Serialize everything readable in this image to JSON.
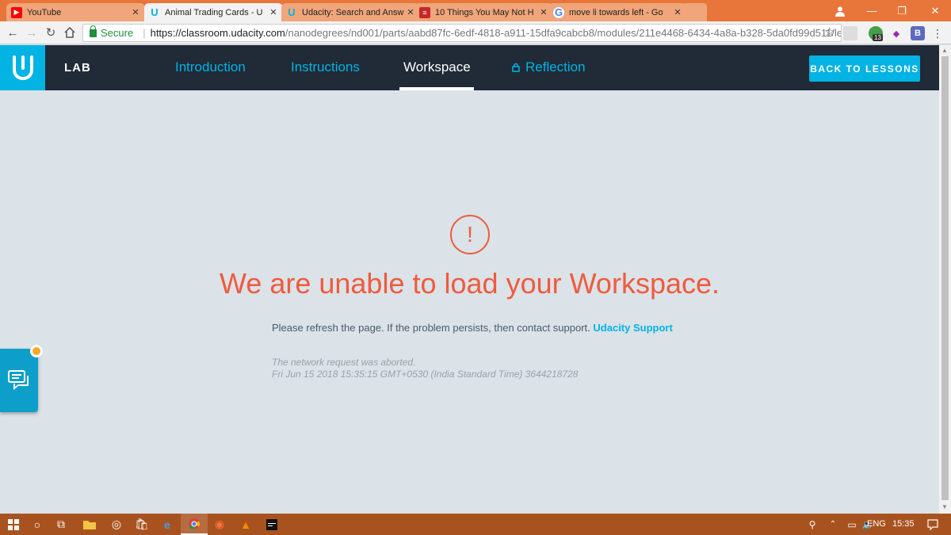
{
  "browser": {
    "tabs": [
      {
        "title": "YouTube",
        "icon": "youtube-icon",
        "color": "#ff0000"
      },
      {
        "title": "Animal Trading Cards - U",
        "icon": "udacity-icon",
        "color": "#02b3e4"
      },
      {
        "title": "Udacity: Search and Answ",
        "icon": "udacity-icon",
        "color": "#02b3e4"
      },
      {
        "title": "10 Things You May Not H",
        "icon": "news-icon",
        "color": "#c62828"
      },
      {
        "title": "move li towards left - Go",
        "icon": "google-icon",
        "color": "#4285f4"
      }
    ],
    "secure_label": "Secure",
    "url_host": "https://classroom.udacity.com",
    "url_path": "/nanodegrees/nd001/parts/aabd87fc-6edf-4818-a911-15dfa9cabcb8/modules/211e4468-6434-4a8a-b328-5da0fd99d511/le...",
    "extension_badge": "13",
    "extension_letter": "B"
  },
  "header": {
    "lab_label": "LAB",
    "tabs": [
      {
        "label": "Introduction"
      },
      {
        "label": "Instructions"
      },
      {
        "label": "Workspace"
      },
      {
        "label": "Reflection",
        "locked": true
      }
    ],
    "back_button": "BACK TO LESSONS"
  },
  "error": {
    "icon_glyph": "!",
    "title": "We are unable to load your Workspace.",
    "message": "Please refresh the page. If the problem persists, then contact support.",
    "support_link": "Udacity Support",
    "detail_line1": "The network request was aborted.",
    "detail_line2": "Fri Jun 15 2018 15:35:15 GMT+0530 (India Standard Time) 3644218728"
  },
  "taskbar": {
    "language": "ENG",
    "time": "15:35"
  },
  "colors": {
    "accent": "#02b3e4",
    "error": "#ef5b3d",
    "header_bg": "#202b37",
    "tabstrip": "#e8763a",
    "taskbar": "#a8531f"
  }
}
